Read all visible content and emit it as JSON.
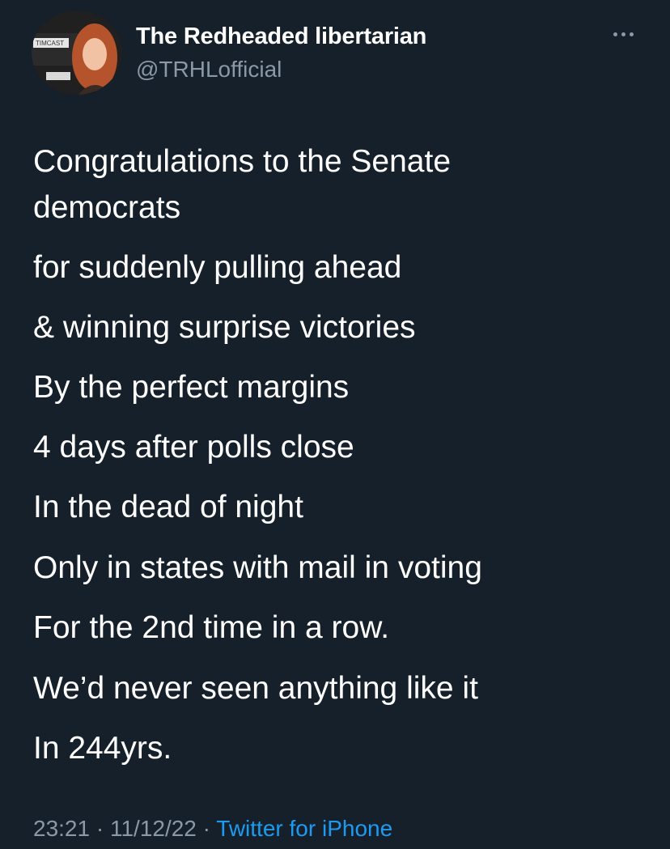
{
  "author": {
    "display_name": "The Redheaded libertarian",
    "handle": "@TRHLofficial",
    "avatar_badge": "TIMCAST"
  },
  "tweet": {
    "lines": [
      "Congratulations to the Senate",
      "democrats",
      "for suddenly pulling ahead",
      "& winning surprise victories",
      "By the perfect margins",
      "4 days after polls close",
      "In the dead of night",
      "Only in states with mail in voting",
      "For the 2nd time in a row.",
      "We’d never seen anything like it",
      "In 244yrs."
    ]
  },
  "meta": {
    "time": "23:21",
    "separator": "·",
    "date": "11/12/22",
    "source": "Twitter for iPhone"
  },
  "icons": {
    "more": "more-horizontal-icon"
  },
  "colors": {
    "background": "#15202b",
    "text": "#ffffff",
    "secondary": "#8b98a5",
    "link": "#1d9bf0"
  }
}
